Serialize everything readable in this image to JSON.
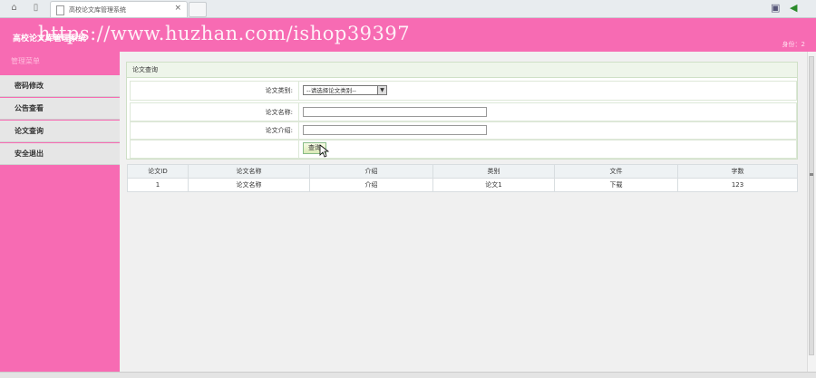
{
  "browser": {
    "tab_title": "高校论文库管理系统",
    "tab_close": "×"
  },
  "header": {
    "app_title": "高校论文库管理系统",
    "watermark": "https://www.huzhan.com/ishop39397",
    "user_info": "身份：2"
  },
  "sidebar": {
    "heading": "管理菜单",
    "items": [
      {
        "label": "密码修改"
      },
      {
        "label": "公告查看"
      },
      {
        "label": "论文查询"
      },
      {
        "label": "安全退出"
      }
    ]
  },
  "query": {
    "title": "论文查询",
    "category_label": "论文类别:",
    "category_value": "--请选择论文类别--",
    "name_label": "论文名称:",
    "name_value": "",
    "intro_label": "论文介绍:",
    "intro_value": "",
    "submit_label": "查询"
  },
  "results": {
    "headers": [
      "论文ID",
      "论文名称",
      "介绍",
      "类别",
      "文件",
      "字数"
    ],
    "rows": [
      [
        "1",
        "论文名称",
        "介绍",
        "论文1",
        "下载",
        "123"
      ]
    ]
  }
}
